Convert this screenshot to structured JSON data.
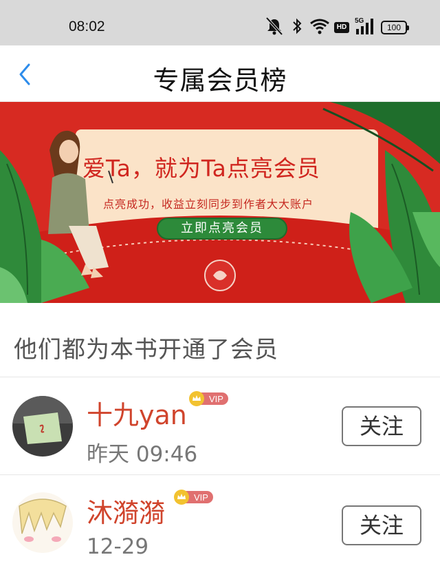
{
  "status_bar": {
    "time": "08:02",
    "icons": [
      "mute-bell-icon",
      "bluetooth-icon",
      "wifi-icon",
      "hd-icon",
      "5g-signal-icon",
      "battery-icon"
    ],
    "hd_label": "HD",
    "network_label": "5G",
    "battery": "100"
  },
  "nav": {
    "back_icon": "chevron-left-icon",
    "title": "专属会员榜",
    "accent": "#2d8ceb"
  },
  "banner": {
    "headline": "爱Ta，就为Ta点亮会员",
    "subtitle": "点亮成功，收益立刻同步到作者大大账户",
    "button": "立即点亮会员",
    "bg_color": "#d72a22",
    "button_color": "#2d8a3a"
  },
  "section_title": "他们都为本书开通了会员",
  "members": [
    {
      "name": "十九yan",
      "badge": "VIP",
      "time": "昨天 09:46",
      "follow_label": "关注"
    },
    {
      "name": "沐漪漪",
      "badge": "VIP",
      "time": "12-29",
      "follow_label": "关注"
    }
  ],
  "colors": {
    "name_color": "#d0442c",
    "vip_badge": "#e07070"
  }
}
